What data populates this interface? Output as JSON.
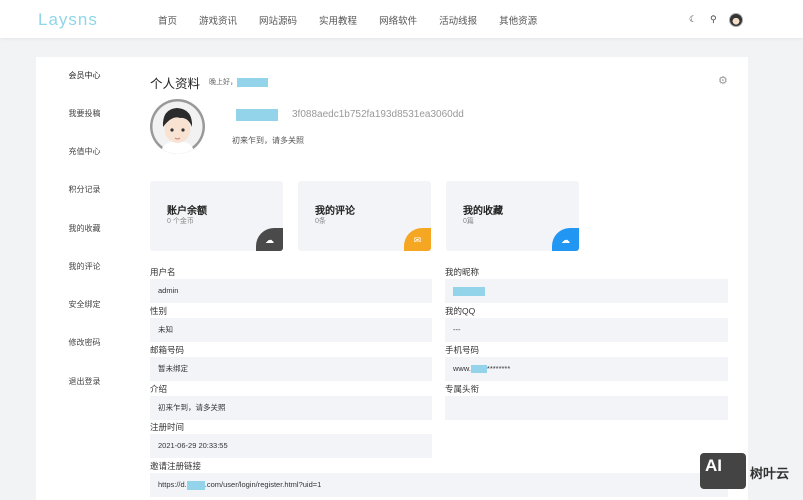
{
  "header": {
    "logo": "Laysns",
    "nav": [
      "首页",
      "游戏资讯",
      "网站源码",
      "实用教程",
      "网络软件",
      "活动线报",
      "其他资源"
    ]
  },
  "sidebar": {
    "items": [
      "会员中心",
      "我要投稿",
      "充值中心",
      "积分记录",
      "我的收藏",
      "我的评论",
      "安全绑定",
      "修改密码",
      "退出登录"
    ]
  },
  "profile": {
    "title": "个人资料",
    "greeting": "晚上好，",
    "hash": "3f088aedc1b752fa193d8531ea3060dd",
    "bio": "初来乍到，请多关照"
  },
  "cards": [
    {
      "title": "账户余额",
      "value": "0 个金币",
      "color": "#4a4a4a",
      "icon": "cloud-download"
    },
    {
      "title": "我的评论",
      "value": "0条",
      "color": "#f5a623",
      "icon": "comment"
    },
    {
      "title": "我的收藏",
      "value": "0篇",
      "color": "#2196f3",
      "icon": "cloud-download"
    }
  ],
  "fields": {
    "username": {
      "label": "用户名",
      "value": "admin"
    },
    "nickname": {
      "label": "我的昵称",
      "value": ""
    },
    "gender": {
      "label": "性别",
      "value": "未知"
    },
    "qq": {
      "label": "我的QQ",
      "value": "---"
    },
    "email": {
      "label": "邮箱号码",
      "value": "暂未绑定"
    },
    "phone": {
      "label": "手机号码",
      "prefix": "www.",
      "suffix": "********"
    },
    "intro": {
      "label": "介绍",
      "value": "初来乍到，请多关照"
    },
    "title": {
      "label": "专属头衔",
      "value": ""
    },
    "regtime": {
      "label": "注册时间",
      "value": "2021-06-29 20:33:55"
    },
    "invite": {
      "label": "邀请注册链接",
      "prefix": "https://d.",
      "suffix": ".com/user/login/register.html?uid=1"
    }
  },
  "watermark": {
    "logo": "AI",
    "text": "树叶云"
  }
}
